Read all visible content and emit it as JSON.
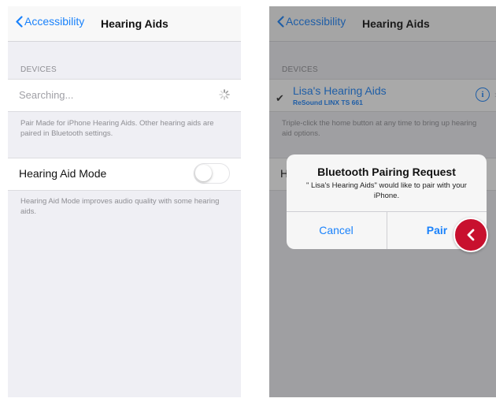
{
  "colors": {
    "accent": "#1a82fb",
    "background": "#efeff4",
    "marker": "#c8102e"
  },
  "left": {
    "back_label": "Accessibility",
    "title": "Hearing Aids",
    "devices_header": "DEVICES",
    "searching_text": "Searching...",
    "pair_note": "Pair Made for iPhone Hearing Aids. Other hearing aids are paired in Bluetooth settings.",
    "mode_label": "Hearing Aid Mode",
    "mode_enabled": false,
    "mode_note": "Hearing Aid Mode improves audio quality with some hearing aids."
  },
  "right": {
    "back_label": "Accessibility",
    "title": "Hearing Aids",
    "devices_header": "DEVICES",
    "device_name": "Lisa's Hearing Aids",
    "device_model": "ReSound LINX TS 661",
    "triple_click_note": "Triple-click the home button at any time to bring up hearing aid options.",
    "mode_label_partial": "H",
    "alert": {
      "title": "Bluetooth Pairing Request",
      "message": "\" Lisa's Hearing Aids\" would like to pair with your iPhone.",
      "cancel_label": "Cancel",
      "pair_label": "Pair"
    }
  },
  "icons": {
    "back": "chevron-left-icon",
    "spinner": "activity-spinner-icon",
    "checkmark": "checkmark-icon",
    "info": "info-icon",
    "marker": "chevron-left-icon"
  }
}
